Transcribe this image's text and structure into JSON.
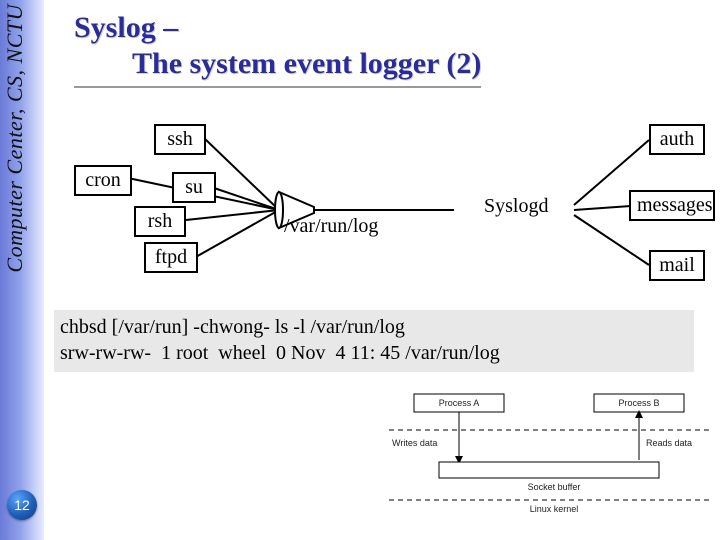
{
  "rail": {
    "label": "Computer Center, CS, NCTU",
    "page_number": "12"
  },
  "title": {
    "line1_a": "Syslog",
    "line1_b": " – ",
    "line2": "The system event logger (2)"
  },
  "diagram": {
    "senders": {
      "ssh": "ssh",
      "cron": "cron",
      "su": "su",
      "rsh": "rsh",
      "ftpd": "ftpd"
    },
    "socket": "/var/run/log",
    "daemon": "Syslogd",
    "sinks": {
      "auth": "auth",
      "messages": "messages",
      "mail": "mail"
    }
  },
  "terminal": {
    "line1": "chbsd [/var/run] -chwong- ls -l /var/run/log",
    "line2": "srw-rw-rw-  1 root  wheel  0 Nov  4 11: 45 /var/run/log"
  },
  "procdiag": {
    "proc_a": "Process A",
    "proc_b": "Process B",
    "writes": "Writes data",
    "reads": "Reads data",
    "socket_buffer": "Socket buffer",
    "kernel": "Linux kernel"
  }
}
